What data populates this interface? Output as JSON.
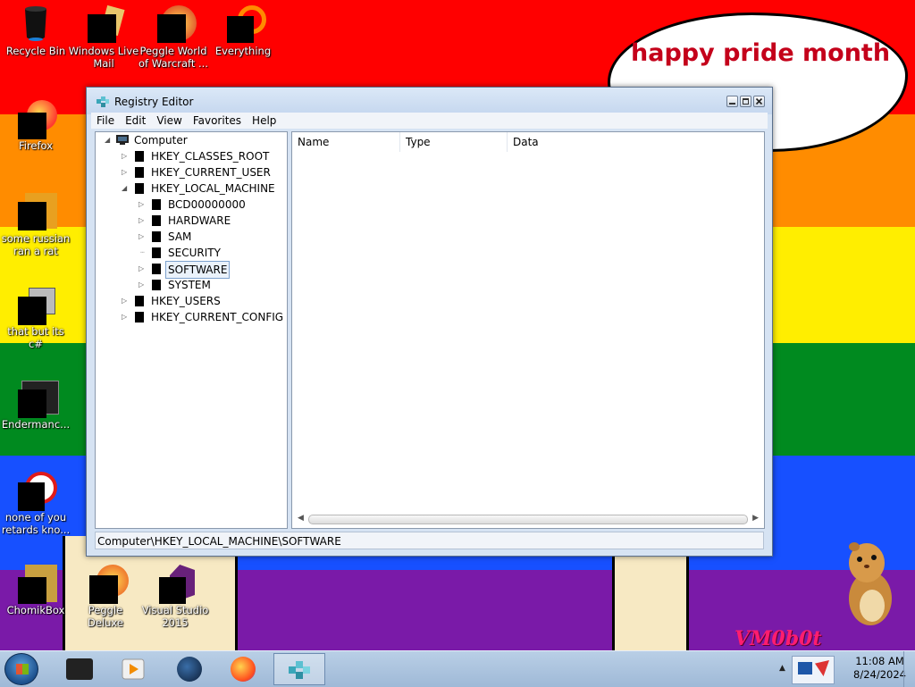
{
  "wallpaper": {
    "bubble_text": "happy pride month",
    "watermark": "VM0b0t",
    "colors": [
      "#ff0000",
      "#ff8c00",
      "#ffee00",
      "#008a1f",
      "#1750ff",
      "#7a1aa8"
    ]
  },
  "desktop_icons": {
    "recycle_bin": "Recycle Bin",
    "windows_live_mail": "Windows Live Mail",
    "peggle_wow": "Peggle World of Warcraft ...",
    "everything": "Everything",
    "firefox": "Firefox",
    "russian": "some russian ran a rat",
    "thatbut": "that but its c#",
    "enderman": "Endermanc...",
    "noneofyou": "none of you retards kno...",
    "chomikbox": "ChomikBox",
    "peggle_deluxe": "Peggle Deluxe",
    "visual_studio": "Visual Studio 2015"
  },
  "window": {
    "title": "Registry Editor",
    "menu": [
      "File",
      "Edit",
      "View",
      "Favorites",
      "Help"
    ],
    "tree": {
      "root": "Computer",
      "hkcr": "HKEY_CLASSES_ROOT",
      "hkcu": "HKEY_CURRENT_USER",
      "hklm": "HKEY_LOCAL_MACHINE",
      "bcd": "BCD00000000",
      "hardware": "HARDWARE",
      "sam": "SAM",
      "security": "SECURITY",
      "software": "SOFTWARE",
      "system": "SYSTEM",
      "hku": "HKEY_USERS",
      "hkcc": "HKEY_CURRENT_CONFIG"
    },
    "columns": [
      "Name",
      "Type",
      "Data"
    ],
    "status": "Computer\\HKEY_LOCAL_MACHINE\\SOFTWARE"
  },
  "taskbar": {
    "time": "11:08 AM",
    "date": "8/24/2024"
  }
}
